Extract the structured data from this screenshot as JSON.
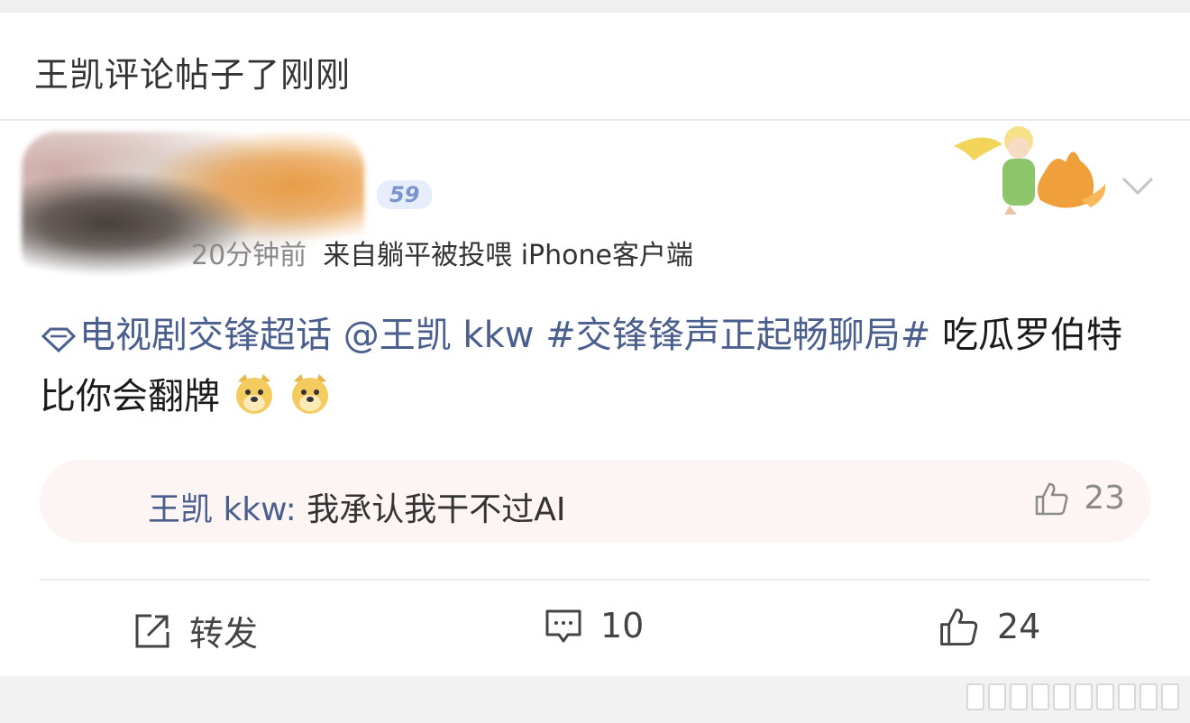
{
  "header": {
    "title": "王凯评论帖子了刚刚"
  },
  "post": {
    "level": "59",
    "time": "20分钟前",
    "source": "来自躺平被投喂 iPhone客户端",
    "supertopic": "电视剧交锋超话",
    "mention": "@王凯 kkw",
    "hashtag": "#交锋锋声正起畅聊局#",
    "text": "吃瓜罗伯特比你会翻牌"
  },
  "reply": {
    "author": "王凯 kkw:",
    "text": "我承认我干不过AI",
    "likes": "23"
  },
  "actions": {
    "repost_label": "转发",
    "comments": "10",
    "likes": "24"
  }
}
